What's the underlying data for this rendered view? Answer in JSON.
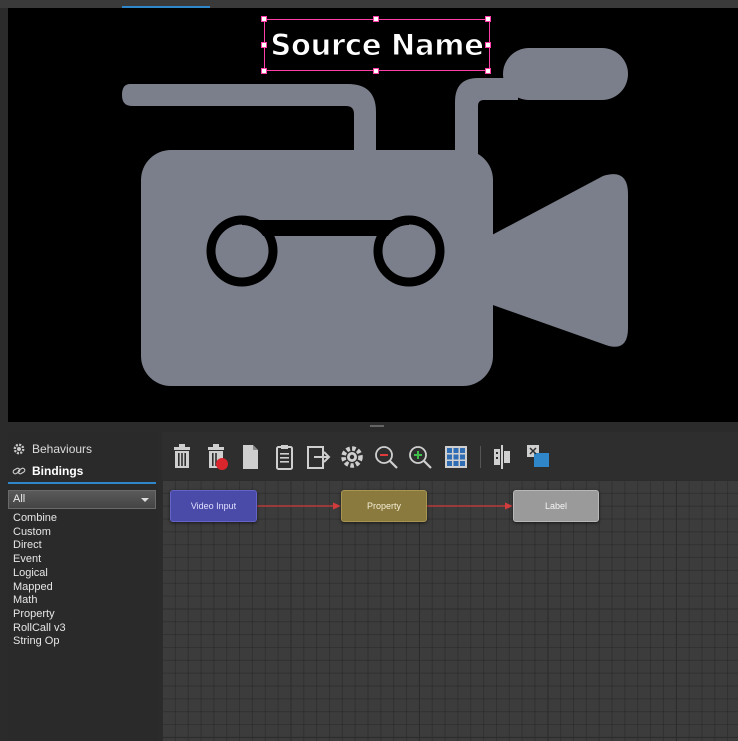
{
  "canvas": {
    "title_text": "Source Name",
    "selection_color": "#ff3fa8",
    "graphic": "video-camera-icon",
    "graphic_color": "#7b7f8b"
  },
  "left_panel": {
    "tabs": [
      {
        "label": "Behaviours",
        "icon": "gear-icon",
        "active": false
      },
      {
        "label": "Bindings",
        "icon": "link-icon",
        "active": true
      }
    ],
    "filter": {
      "selected": "All"
    },
    "binding_types": [
      "Combine",
      "Custom",
      "Direct",
      "Event",
      "Logical",
      "Mapped",
      "Math",
      "Property",
      "RollCall v3",
      "String Op"
    ]
  },
  "toolbar": {
    "buttons": [
      "trash-icon",
      "trash-delete-icon",
      "copy-icon",
      "paste-icon",
      "export-icon",
      "settings-icon",
      "zoom-out-icon",
      "zoom-in-icon",
      "fit-view-icon",
      "align-icon",
      "arrange-icon"
    ]
  },
  "graph": {
    "nodes": [
      {
        "label": "Video Input",
        "color": "#4a4aa8"
      },
      {
        "label": "Property",
        "color": "#8a7a3e"
      },
      {
        "label": "Label",
        "color": "#9a9a9a"
      }
    ],
    "wire_color": "#d23c3c",
    "accent": "#2f86c9"
  }
}
